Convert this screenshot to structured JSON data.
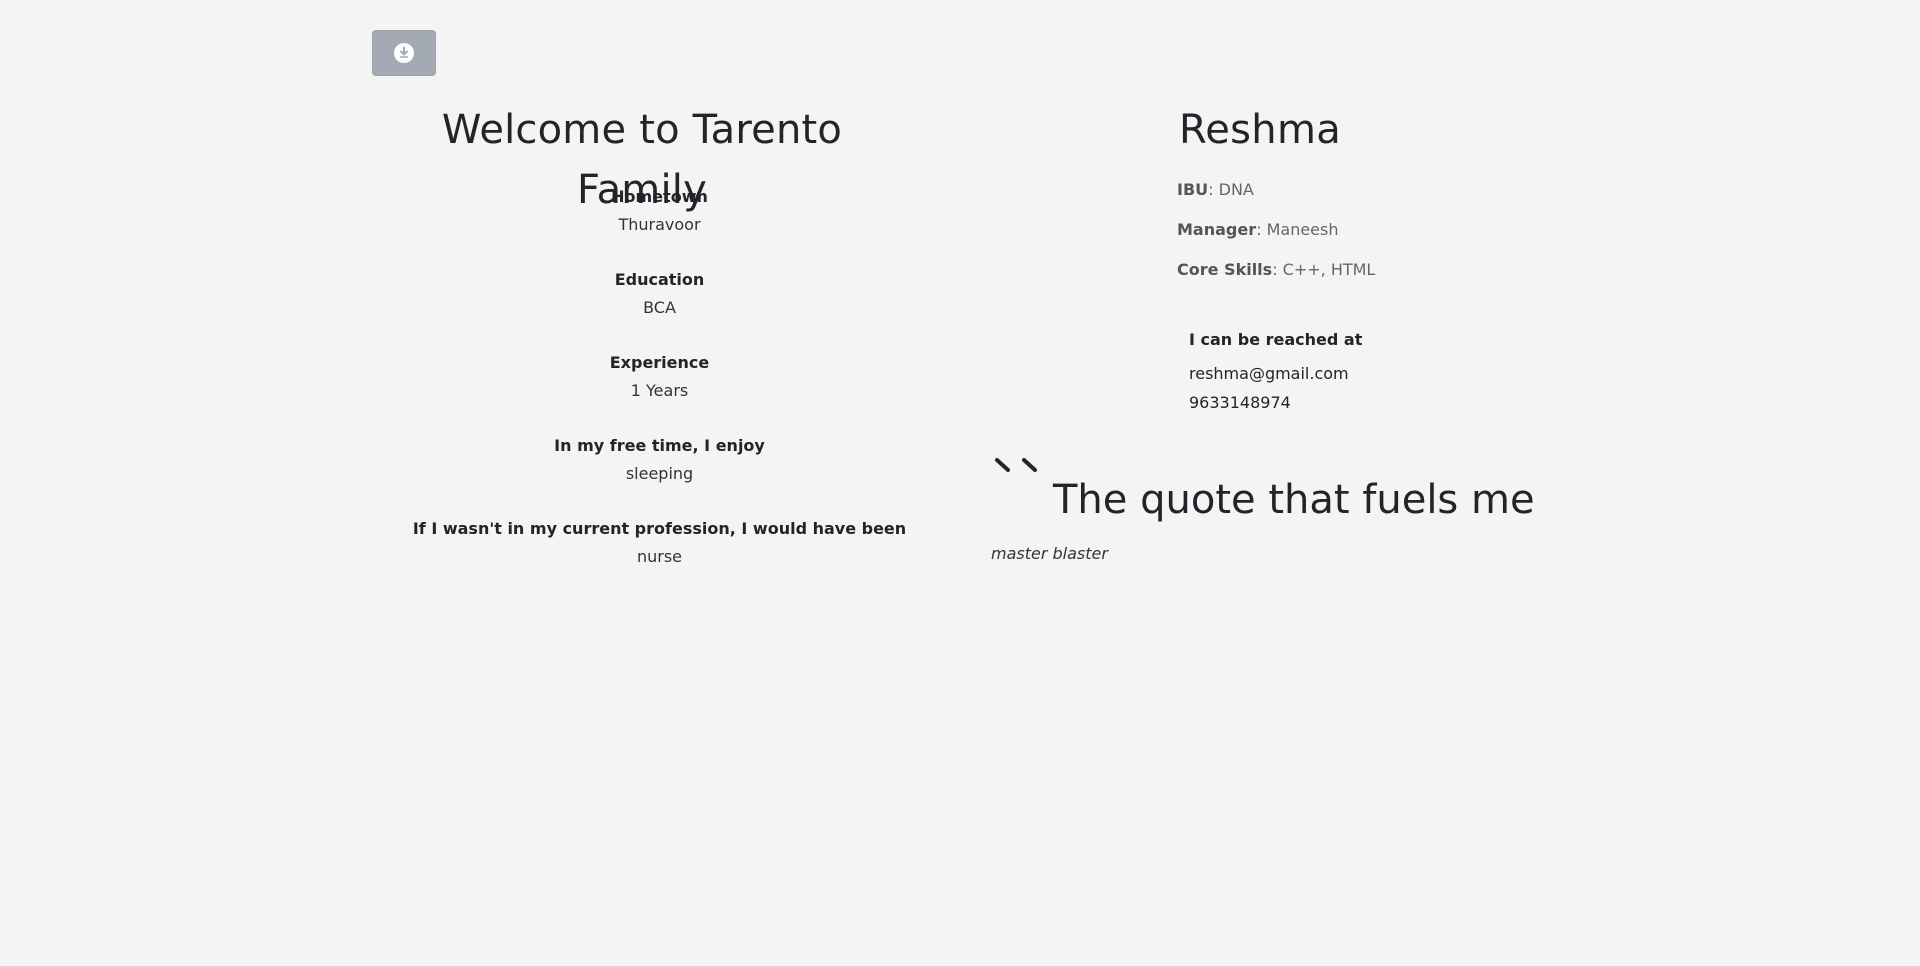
{
  "toolbar": {
    "download_icon": "download-icon"
  },
  "profile": {
    "welcome_title": "Welcome to Tarento Family",
    "name": "Reshma",
    "info": [
      {
        "label": "Hometown",
        "value": "Thuravoor"
      },
      {
        "label": "Education",
        "value": "BCA"
      },
      {
        "label": "Experience",
        "value": "1 Years"
      },
      {
        "label": "In my free time, I enjoy",
        "value": "sleeping"
      },
      {
        "label": "If I wasn't in my current profession, I would have been",
        "value": "nurse"
      }
    ],
    "details": {
      "ibu_label": "IBU",
      "ibu_value": ": DNA",
      "manager_label": "Manager",
      "manager_value": ": Maneesh",
      "skills_label": "Core Skills",
      "skills_value": ": C++, HTML"
    },
    "contact": {
      "heading": "I can be reached at",
      "email": "reshma@gmail.com",
      "phone": "9633148974"
    },
    "quote": {
      "heading": "The quote that fuels me",
      "text": "master blaster"
    }
  },
  "colors": {
    "background": "#f4f4f4",
    "button_bg": "#a3aab4",
    "text": "#212529",
    "muted": "#666666"
  }
}
